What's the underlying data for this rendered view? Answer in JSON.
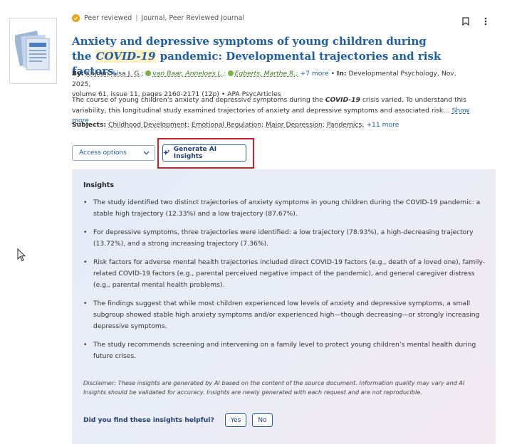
{
  "badge": {
    "reviewed": "Peer reviewed",
    "type": "Journal, Peer Reviewed Journal"
  },
  "title": {
    "before": "Anxiety and depressive symptoms of young children during the ",
    "highlight": "COVID-19",
    "after": " pandemic: Developmental trajectories and risk factors."
  },
  "meta": {
    "by_label": "By:",
    "author1": "Krijnen, Lisa J. G.;",
    "author2": "van Baar, Anneloes L.;",
    "author3": "Egberts, Marthe R.;",
    "more_authors": "+7 more",
    "sep": "•",
    "in_label": "In:",
    "source_line1": "Developmental Psychology, Nov, 2025,",
    "source_line2": "volume 61, issue 11, pages 2160-2171 (12p)",
    "database": "APA PsycArticles"
  },
  "abstract": {
    "part1": "The course of young children’s anxiety and depressive symptoms during the ",
    "term": "COVID-19",
    "part2": " crisis varied. To understand this",
    "line2": "variability, this longitudinal study examined trajectories of anxiety and depressive symptoms and associated risk…",
    "show_more": "Show more"
  },
  "subjects": {
    "label": "Subjects:",
    "items": [
      "Childhood Development;",
      "Emotional Regulation;",
      "Major Depression;",
      "Pandemics;"
    ],
    "more": "+11 more"
  },
  "actions": {
    "access": "Access options",
    "generate": "Generate AI Insights"
  },
  "insights": {
    "heading": "Insights",
    "items": [
      "The study identified two distinct trajectories of anxiety symptoms in young children during the COVID-19 pandemic: a stable high trajectory (12.33%) and a low trajectory (87.67%).",
      "For depressive symptoms, three trajectories were identified: a low trajectory (78.93%), a high-decreasing trajectory (13.72%), and a strong increasing trajectory (7.36%).",
      "Risk factors for adverse mental health trajectories included direct COVID-19 factors (e.g., death of a loved one), family-related COVID-19 factors (e.g., parental perceived negative impact of the pandemic), and general caregiver distress (e.g., parental mental health problems).",
      "The findings suggest that while most children experienced low levels of anxiety and depressive symptoms, a small subgroup showed stable high anxiety symptoms and/or experienced high—though decreasing—or strongly increasing depressive symptoms.",
      "The study recommends screening and intervening on a family level to protect young children’s mental health during future crises."
    ],
    "disclaimer": "Disclaimer: These insights are generated by AI based on the content of the source document. Information quality may vary and AI Insights should be validated for accuracy. Insights are newly generated with each request and are not reproducible.",
    "feedback_question": "Did you find these insights helpful?",
    "yes": "Yes",
    "no": "No"
  },
  "colors": {
    "link": "#1f5ea8",
    "highlight_box": "#d32027",
    "badge": "#e8a317"
  }
}
